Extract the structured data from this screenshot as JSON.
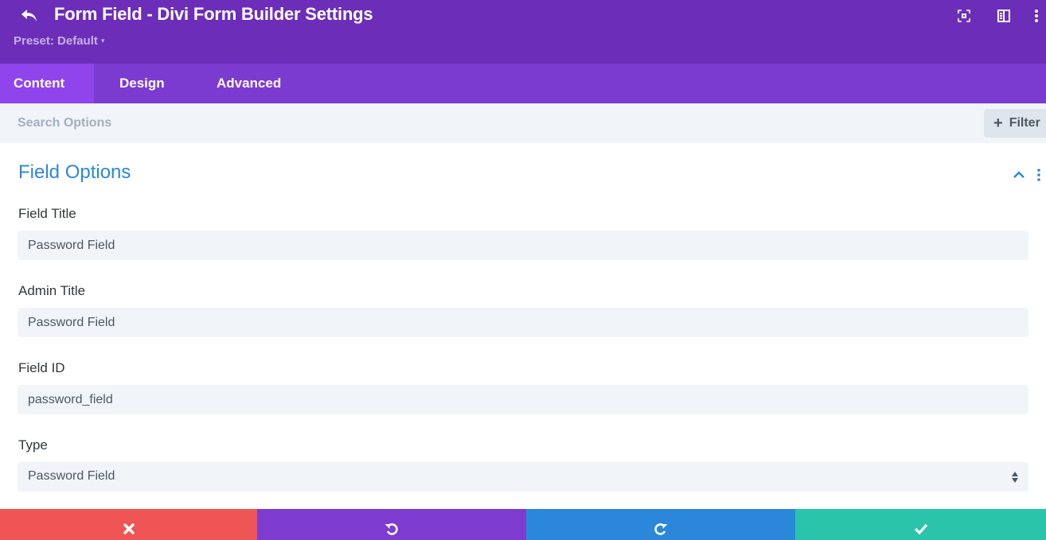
{
  "header": {
    "title": "Form Field - Divi Form Builder Settings",
    "preset_label": "Preset: Default",
    "preset_caret": "▾",
    "icons": [
      "undo-back-icon",
      "focus-expand-icon",
      "sidebar-layout-icon",
      "more-vertical-icon"
    ],
    "colors": {
      "header_bg": "#6c2eb9",
      "tabs_bg": "#7b3bd0",
      "active_tab_bg": "#8f44ec"
    }
  },
  "tabs": [
    {
      "label": "Content",
      "active": true
    },
    {
      "label": "Design",
      "active": false
    },
    {
      "label": "Advanced",
      "active": false
    }
  ],
  "search": {
    "placeholder": "Search Options",
    "value": "",
    "filter_label": "Filter",
    "filter_icon": "+"
  },
  "section": {
    "title": "Field Options",
    "expanded": true,
    "accent": "#2b87da"
  },
  "fields": [
    {
      "label": "Field Title",
      "value": "Password Field",
      "type": "text"
    },
    {
      "label": "Admin Title",
      "value": "Password Field",
      "type": "text"
    },
    {
      "label": "Field ID",
      "value": "password_field",
      "type": "text"
    },
    {
      "label": "Type",
      "value": "Password Field",
      "type": "select"
    }
  ],
  "actions": [
    {
      "name": "discard",
      "icon": "close-icon",
      "color": "#ef5555"
    },
    {
      "name": "undo",
      "icon": "undo-icon",
      "color": "#7e3bd0"
    },
    {
      "name": "redo",
      "icon": "redo-icon",
      "color": "#2b87da"
    },
    {
      "name": "save",
      "icon": "check-icon",
      "color": "#29c4a9"
    }
  ]
}
